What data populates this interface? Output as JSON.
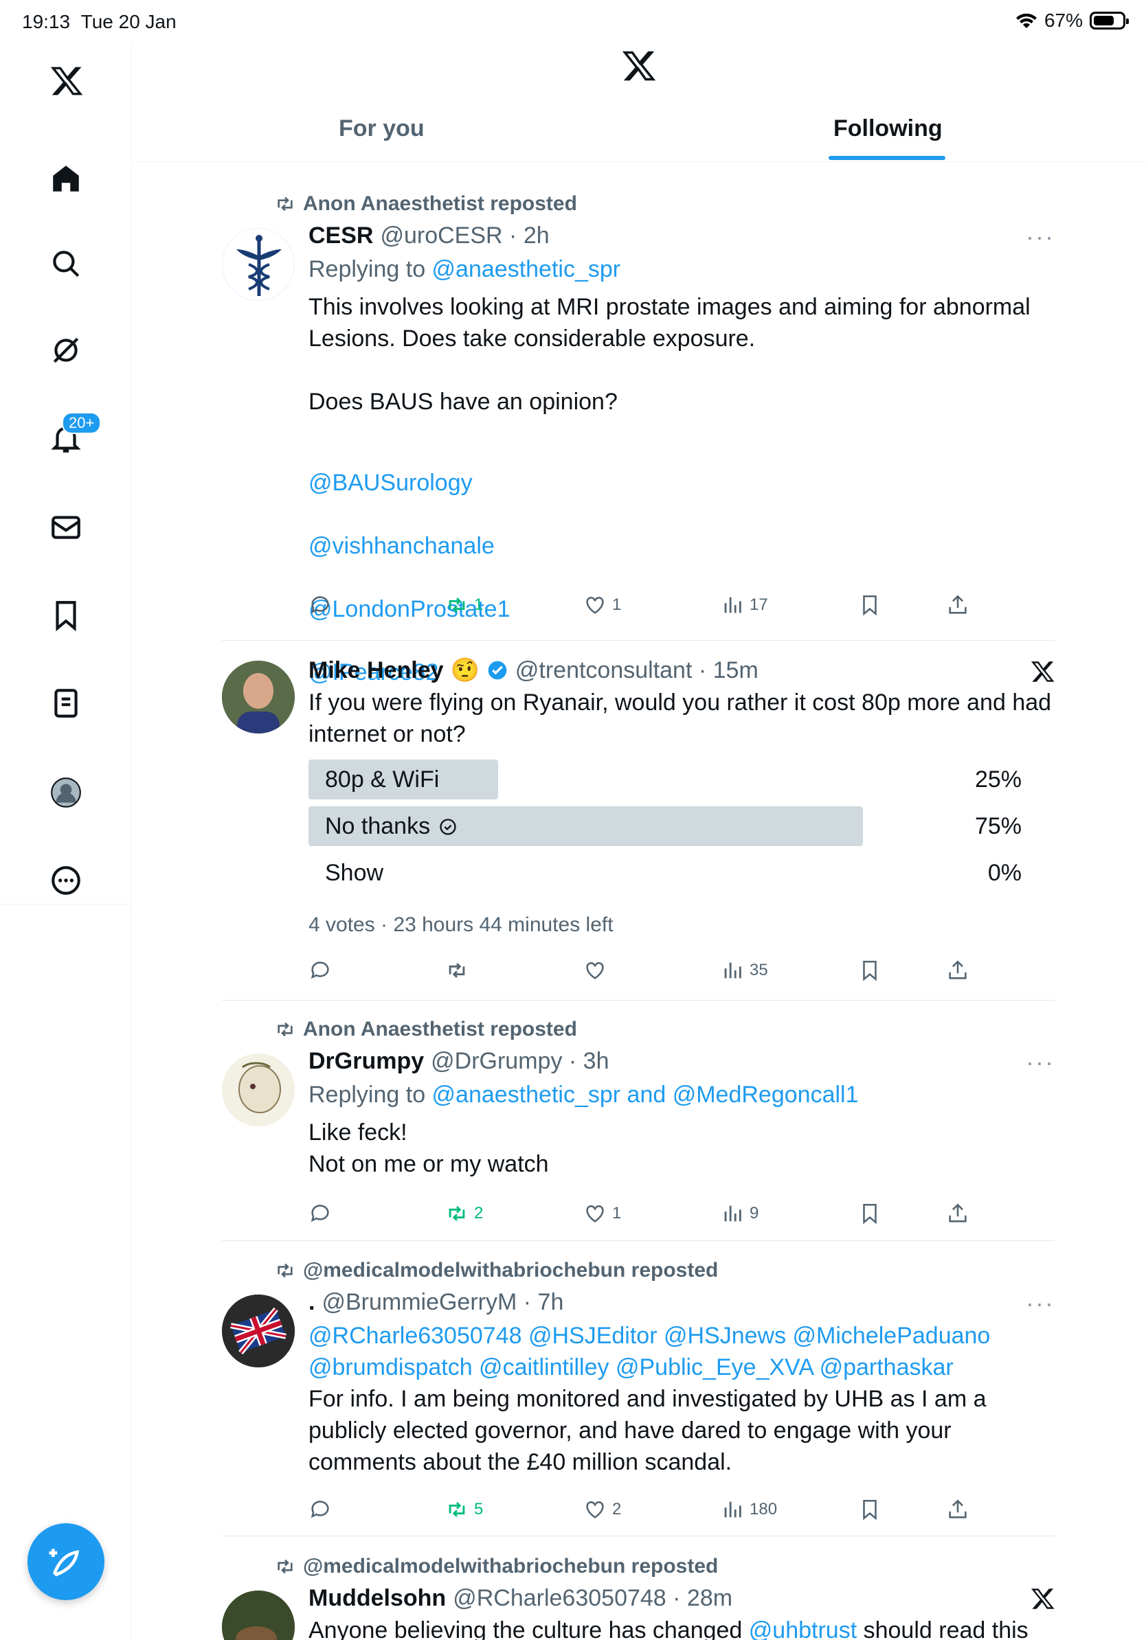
{
  "status_bar": {
    "time": "19:13",
    "date": "Tue 20 Jan",
    "battery": "67%"
  },
  "sidebar": {
    "notifications_badge": "20+",
    "items": [
      "home",
      "explore",
      "grok",
      "notifications",
      "messages",
      "bookmarks",
      "lists",
      "profile",
      "more"
    ]
  },
  "header": {
    "tabs": [
      {
        "label": "For you"
      },
      {
        "label": "Following",
        "selected": true
      }
    ]
  },
  "posts": [
    {
      "repost_by": "Anon Anaesthetist reposted",
      "name": "CESR",
      "handle": "@uroCESR",
      "time": "2h",
      "replying_prefix": "Replying to ",
      "replying_to": "@anaesthetic_spr",
      "text": "This involves looking at MRI prostate images and aiming for abnormal\nLesions.  Does take considerable exposure.\n\nDoes BAUS have an opinion?",
      "mentions": [
        "@BAUSurology",
        "@vishhanchanale",
        "@LondonProstate1",
        "@IPearce82"
      ],
      "stats": {
        "reposts": "1",
        "likes": "1",
        "views": "17"
      }
    },
    {
      "name": "Mike Henley",
      "emoji": "🤨",
      "verified": true,
      "handle": "@trentconsultant",
      "time": "15m",
      "text": "If you were flying on Ryanair, would you rather it cost 80p more and had\ninternet or not?",
      "poll": {
        "options": [
          {
            "label": "80p & WiFi",
            "percent": "25%",
            "fill": 0.25
          },
          {
            "label": "No thanks",
            "percent": "75%",
            "fill": 0.75,
            "chosen": true
          },
          {
            "label": "Show",
            "percent": "0%",
            "fill": 0
          }
        ],
        "meta": "4 votes · 23 hours 44 minutes left"
      },
      "stats": {
        "views": "35"
      }
    },
    {
      "repost_by": "Anon Anaesthetist reposted",
      "name": "DrGrumpy",
      "handle": "@DrGrumpy",
      "time": "3h",
      "replying_prefix": "Replying to ",
      "replying_to": "@anaesthetic_spr and @MedRegoncall1",
      "text": "Like feck!\nNot on me or my watch",
      "stats": {
        "reposts": "2",
        "likes": "1",
        "views": "9"
      }
    },
    {
      "repost_by": "@medicalmodelwithabriochebun reposted",
      "name": ".",
      "handle": "@BrummieGerryM",
      "time": "7h",
      "mentions_line1": "@RCharle63050748 @HSJEditor @HSJnews @MichelePaduano",
      "mentions_line2": "@brumdispatch @caitlintilley @Public_Eye_XVA @parthaskar",
      "text": "For info. I am being monitored and investigated by UHB as I am a\npublicly elected governor, and have dared to engage with your\ncomments about the £40 million scandal.",
      "stats": {
        "reposts": "5",
        "likes": "2",
        "views": "180"
      }
    },
    {
      "repost_by": "@medicalmodelwithabriochebun reposted",
      "name": "Muddelsohn",
      "handle": "@RCharle63050748",
      "time": "28m",
      "text_prefix": "Anyone believing the culture has changed ",
      "text_link": "@uhbtrust",
      "text_suffix": " should read this"
    }
  ],
  "colors": {
    "accent": "#1d9bf0",
    "repost_green": "#00ba7c",
    "muted": "#536471"
  }
}
